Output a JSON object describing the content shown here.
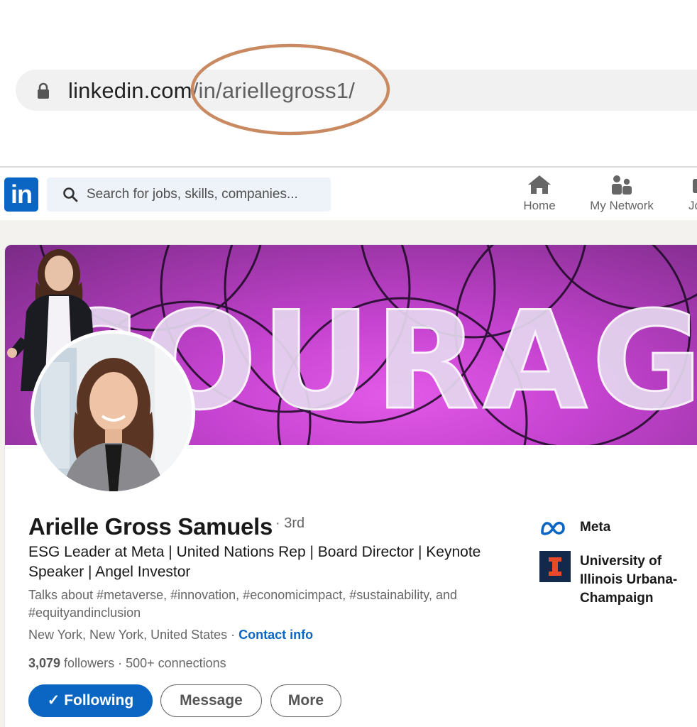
{
  "browser": {
    "url_domain": "linkedin.com",
    "url_path": "/in/ariellegross1/",
    "annotation_color": "#c98a62"
  },
  "nav": {
    "logo_text": "in",
    "search_placeholder": "Search for jobs, skills, companies...",
    "items": [
      {
        "label": "Home",
        "icon": "home-icon"
      },
      {
        "label": "My Network",
        "icon": "my-network-icon"
      },
      {
        "label": "Jo",
        "icon": "jobs-icon"
      }
    ]
  },
  "banner": {
    "word": "COURAGE"
  },
  "profile": {
    "name": "Arielle Gross Samuels",
    "degree": "· 3rd",
    "headline": "ESG Leader at Meta | United Nations Rep | Board Director | Keynote Speaker | Angel Investor",
    "talks_about": "Talks about #metaverse, #innovation, #economicimpact, #sustainability, and #equityandinclusion",
    "location": "New York, New York, United States",
    "location_sep": " · ",
    "contact_label": "Contact info",
    "followers_count": "3,079",
    "followers_label": " followers",
    "connections_text": " · 500+ connections"
  },
  "actions": {
    "following_label": "✓ Following",
    "message_label": "Message",
    "more_label": "More"
  },
  "experience": {
    "company": "Meta",
    "school": "University of Illinois Urbana-Champaign",
    "school_logo_letter": "I"
  },
  "colors": {
    "linkedin_blue": "#0a66c2",
    "illinois_navy": "#13294b",
    "illinois_orange": "#e84a27",
    "banner_magenta": "#c543d0"
  }
}
